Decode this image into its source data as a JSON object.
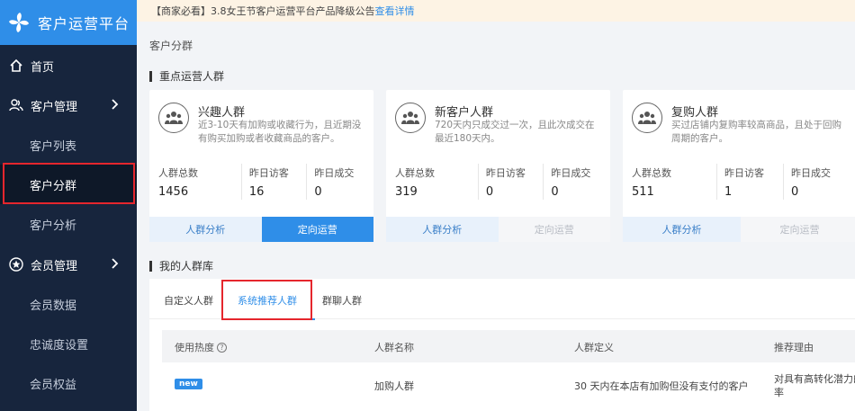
{
  "app": {
    "title": "客户运营平台"
  },
  "sidebar": {
    "home": "首页",
    "customer_mgmt": "客户管理",
    "customer_list": "客户列表",
    "customer_group": "客户分群",
    "customer_analysis": "客户分析",
    "member_mgmt": "会员管理",
    "member_data": "会员数据",
    "loyalty_settings": "忠诚度设置",
    "member_rights": "会员权益"
  },
  "notice": {
    "text": "【商家必看】3.8女王节客户运营平台产品降级公告",
    "link": "查看详情"
  },
  "page": {
    "title": "客户分群"
  },
  "sections": {
    "key_groups": "重点运营人群",
    "my_library": "我的人群库"
  },
  "cards": [
    {
      "title": "兴趣人群",
      "desc": "近3-10天有加购或收藏行为，且近期没有购买加购或者收藏商品的客户。",
      "stats": [
        {
          "label": "人群总数",
          "value": "1456"
        },
        {
          "label": "昨日访客",
          "value": "16"
        },
        {
          "label": "昨日成交",
          "value": "0"
        }
      ],
      "btn_analysis": "人群分析",
      "btn_target": "定向运营"
    },
    {
      "title": "新客户人群",
      "desc": "720天内只成交过一次，且此次成交在最近180天内。",
      "stats": [
        {
          "label": "人群总数",
          "value": "319"
        },
        {
          "label": "昨日访客",
          "value": "0"
        },
        {
          "label": "昨日成交",
          "value": "0"
        }
      ],
      "btn_analysis": "人群分析",
      "btn_target": "定向运营"
    },
    {
      "title": "复购人群",
      "desc": "买过店铺内复购率较高商品，且处于回购周期的客户。",
      "stats": [
        {
          "label": "人群总数",
          "value": "511"
        },
        {
          "label": "昨日访客",
          "value": "1"
        },
        {
          "label": "昨日成交",
          "value": "0"
        }
      ],
      "btn_analysis": "人群分析",
      "btn_target": "定向运营"
    }
  ],
  "library": {
    "tabs": [
      "自定义人群",
      "系统推荐人群",
      "群聊人群"
    ],
    "columns": {
      "heat": "使用热度",
      "name": "人群名称",
      "definition": "人群定义",
      "reason": "推荐理由"
    },
    "rows": [
      {
        "badge": "new",
        "name": "加购人群",
        "definition": "30 天内在本店有加购但没有支付的客户",
        "reason_line1": "对具有高转化潜力的",
        "reason_line2": "率"
      }
    ]
  },
  "colors": {
    "accent": "#2f8ee8",
    "sidebar": "#17253d",
    "highlight": "#e5262d"
  }
}
